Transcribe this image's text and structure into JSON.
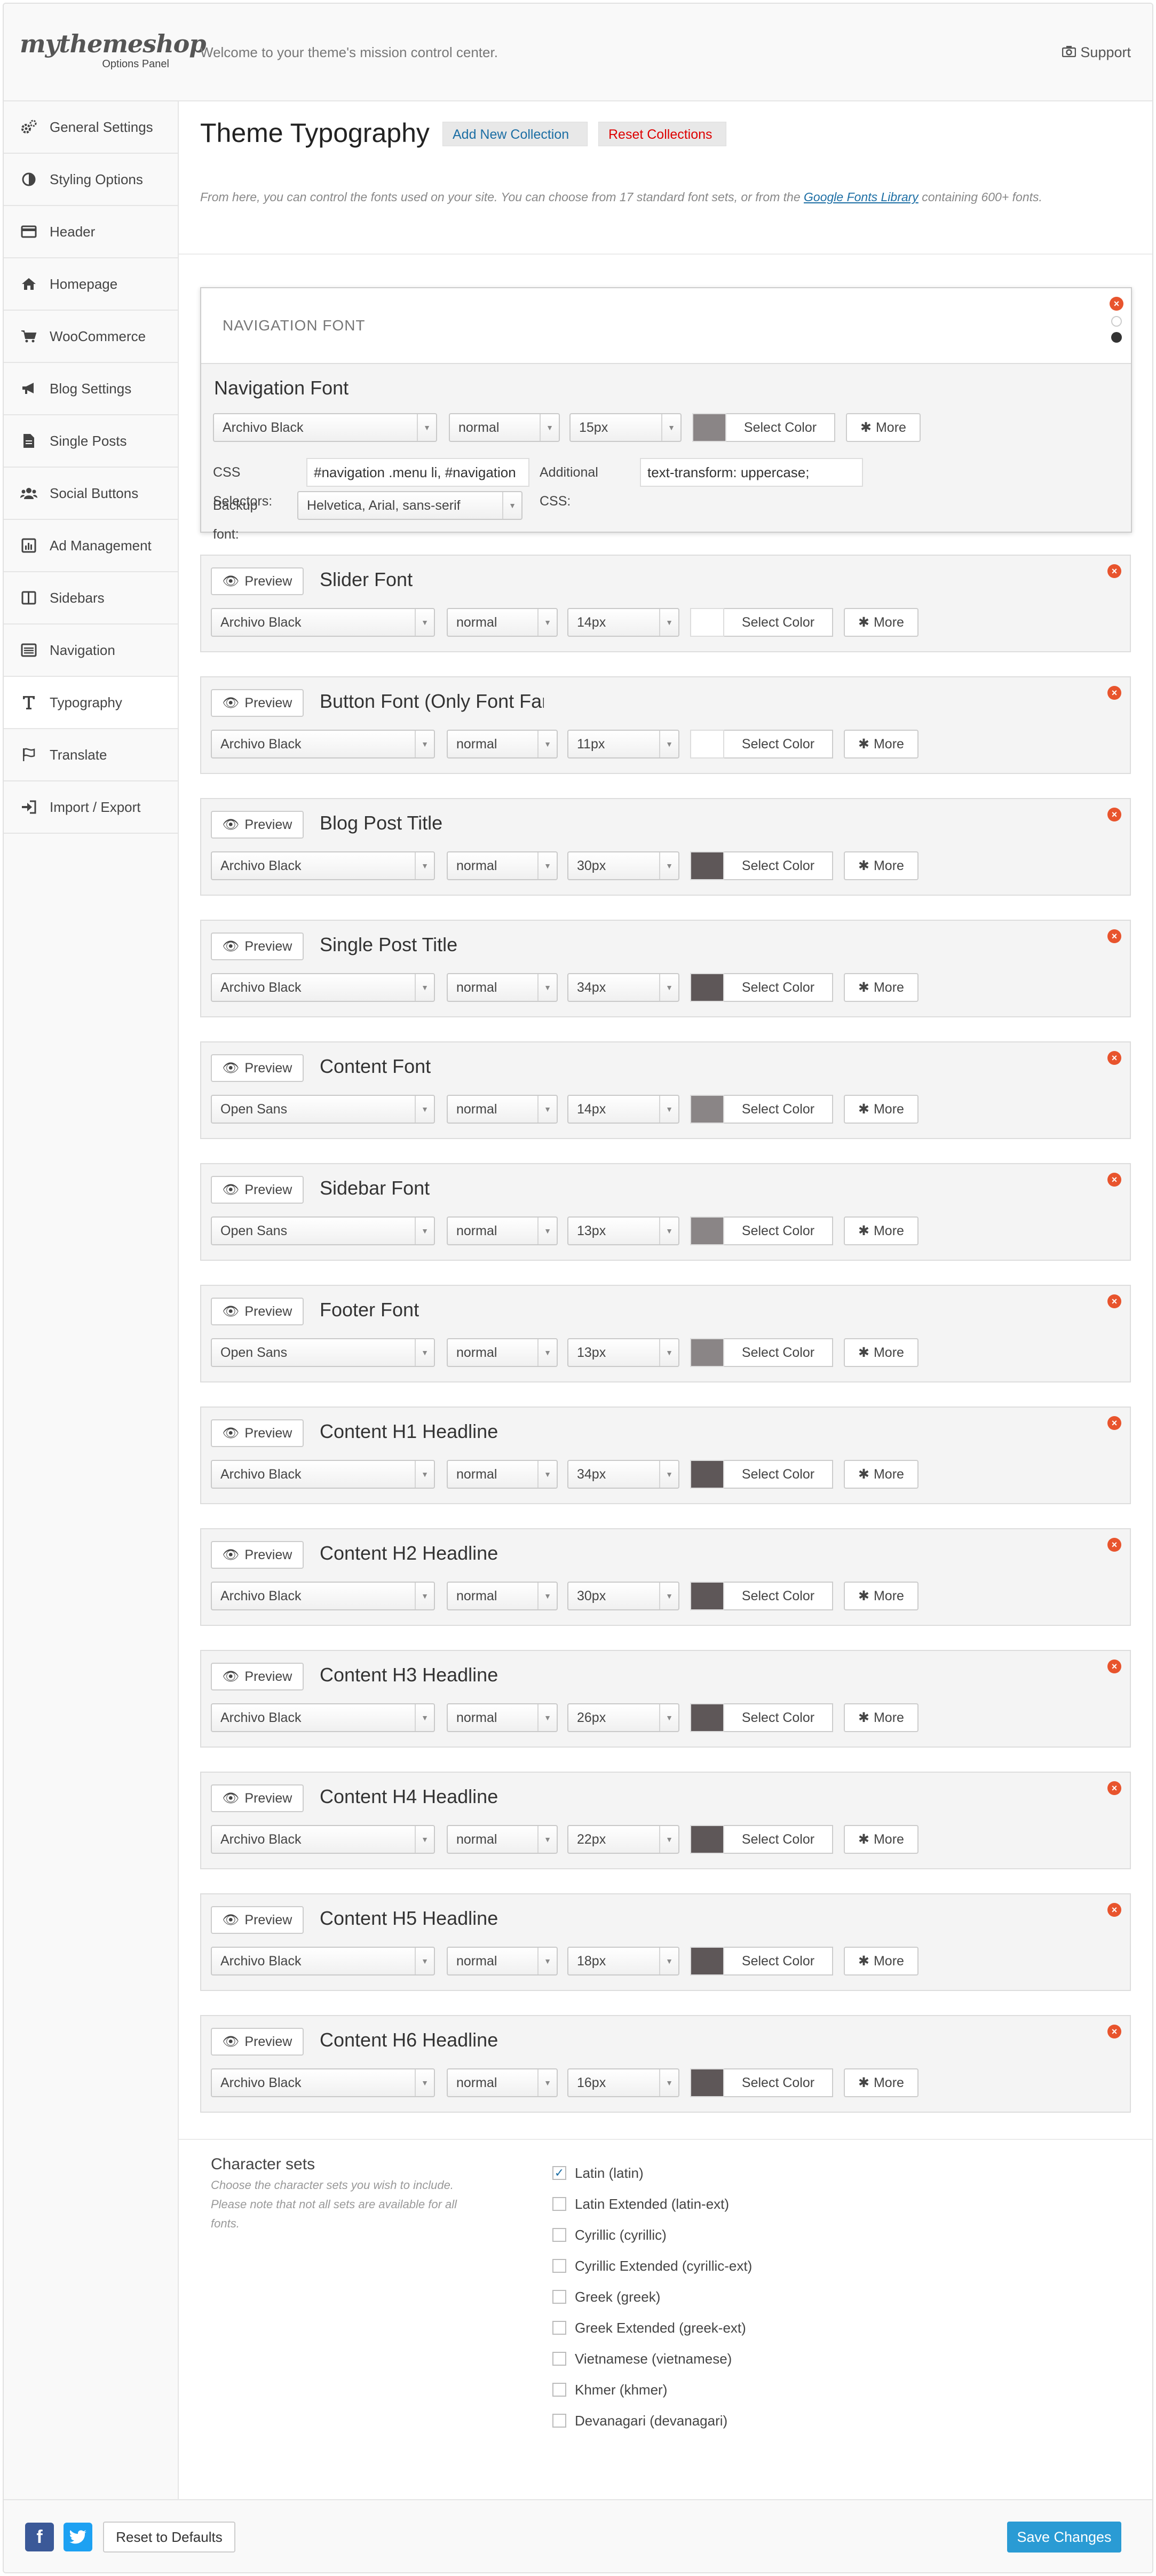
{
  "header": {
    "logo_name": "mythemeshop",
    "logo_sub": "Options Panel",
    "welcome": "Welcome to your theme's mission control center.",
    "support": "Support"
  },
  "sidebar": {
    "items": [
      {
        "label": "General Settings",
        "icon": "gears-icon"
      },
      {
        "label": "Styling Options",
        "icon": "contrast-icon"
      },
      {
        "label": "Header",
        "icon": "header-icon"
      },
      {
        "label": "Homepage",
        "icon": "home-icon"
      },
      {
        "label": "WooCommerce",
        "icon": "cart-icon"
      },
      {
        "label": "Blog Settings",
        "icon": "megaphone-icon"
      },
      {
        "label": "Single Posts",
        "icon": "document-icon"
      },
      {
        "label": "Social Buttons",
        "icon": "users-icon"
      },
      {
        "label": "Ad Management",
        "icon": "chart-icon"
      },
      {
        "label": "Sidebars",
        "icon": "columns-icon"
      },
      {
        "label": "Navigation",
        "icon": "list-icon"
      },
      {
        "label": "Typography",
        "icon": "text-icon"
      },
      {
        "label": "Translate",
        "icon": "flag-icon"
      },
      {
        "label": "Import / Export",
        "icon": "sign-in-icon"
      }
    ],
    "active": "Typography"
  },
  "main": {
    "title": "Theme Typography",
    "add_collection": "Add New Collection",
    "reset_collections": "Reset Collections",
    "intro_before": "From here, you can control the fonts used on your site. You can choose from 17 standard font sets, or from the ",
    "intro_link": "Google Fonts Library",
    "intro_after": " containing 600+ fonts."
  },
  "nav_font": {
    "header_label": "NAVIGATION FONT",
    "name": "Navigation Font",
    "font": "Archivo Black",
    "weight": "normal",
    "size": "15px",
    "color": "#8a8586",
    "select_color": "Select Color",
    "more": "More",
    "css_selectors_label": "CSS Selectors:",
    "css_selectors_value": "#navigation .menu li, #navigation",
    "additional_css_label": "Additional CSS:",
    "additional_css_value": "text-transform: uppercase;",
    "backup_font_label": "Backup font:",
    "backup_font_value": "Helvetica, Arial, sans-serif"
  },
  "preview_label": "Preview",
  "select_color_label": "Select Color",
  "more_label": "More",
  "fonts": [
    {
      "name": "Slider Font",
      "font": "Archivo Black",
      "weight": "normal",
      "size": "14px",
      "color": "#ffffff"
    },
    {
      "name": "Button Font (Only Font Family)",
      "font": "Archivo Black",
      "weight": "normal",
      "size": "11px",
      "color": "#ffffff"
    },
    {
      "name": "Blog Post Title",
      "font": "Archivo Black",
      "weight": "normal",
      "size": "30px",
      "color": "#5e5758"
    },
    {
      "name": "Single Post Title",
      "font": "Archivo Black",
      "weight": "normal",
      "size": "34px",
      "color": "#5e5758"
    },
    {
      "name": "Content Font",
      "font": "Open Sans",
      "weight": "normal",
      "size": "14px",
      "color": "#8a8586"
    },
    {
      "name": "Sidebar Font",
      "font": "Open Sans",
      "weight": "normal",
      "size": "13px",
      "color": "#8a8586"
    },
    {
      "name": "Footer Font",
      "font": "Open Sans",
      "weight": "normal",
      "size": "13px",
      "color": "#8a8586"
    },
    {
      "name": "Content H1 Headline",
      "font": "Archivo Black",
      "weight": "normal",
      "size": "34px",
      "color": "#5e5758"
    },
    {
      "name": "Content H2 Headline",
      "font": "Archivo Black",
      "weight": "normal",
      "size": "30px",
      "color": "#5e5758"
    },
    {
      "name": "Content H3 Headline",
      "font": "Archivo Black",
      "weight": "normal",
      "size": "26px",
      "color": "#5e5758"
    },
    {
      "name": "Content H4 Headline",
      "font": "Archivo Black",
      "weight": "normal",
      "size": "22px",
      "color": "#5e5758"
    },
    {
      "name": "Content H5 Headline",
      "font": "Archivo Black",
      "weight": "normal",
      "size": "18px",
      "color": "#5e5758"
    },
    {
      "name": "Content H6 Headline",
      "font": "Archivo Black",
      "weight": "normal",
      "size": "16px",
      "color": "#5e5758"
    }
  ],
  "charsets": {
    "title": "Character sets",
    "desc": "Choose the character sets you wish to include. Please note that not all sets are available for all fonts.",
    "items": [
      {
        "label": "Latin (latin)",
        "checked": true
      },
      {
        "label": "Latin Extended (latin-ext)",
        "checked": false
      },
      {
        "label": "Cyrillic (cyrillic)",
        "checked": false
      },
      {
        "label": "Cyrillic Extended (cyrillic-ext)",
        "checked": false
      },
      {
        "label": "Greek (greek)",
        "checked": false
      },
      {
        "label": "Greek Extended (greek-ext)",
        "checked": false
      },
      {
        "label": "Vietnamese (vietnamese)",
        "checked": false
      },
      {
        "label": "Khmer (khmer)",
        "checked": false
      },
      {
        "label": "Devanagari (devanagari)",
        "checked": false
      }
    ]
  },
  "footer": {
    "reset_defaults": "Reset to Defaults",
    "save": "Save Changes",
    "facebook_glyph": "f",
    "twitter_glyph": "t"
  },
  "colors": {
    "accent": "#2a9bd4",
    "danger": "#e8542d",
    "link": "#1c6ea4"
  }
}
